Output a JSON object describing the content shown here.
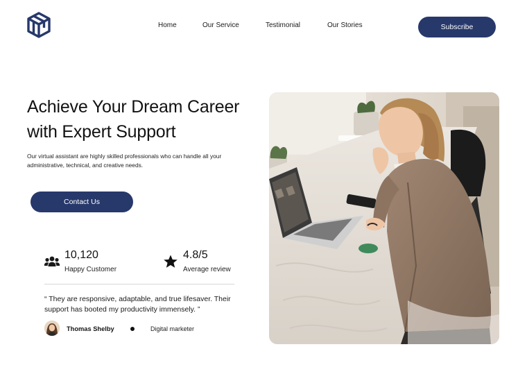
{
  "brand": {
    "logo_icon": "cube-logo-icon",
    "color": "#27386b"
  },
  "nav": {
    "items": [
      {
        "label": "Home"
      },
      {
        "label": "Our Service"
      },
      {
        "label": "Testimonial"
      },
      {
        "label": "Our Stories"
      }
    ],
    "subscribe_label": "Subscribe"
  },
  "hero": {
    "headline_line1": "Achieve Your Dream Career",
    "headline_line2": "with Expert Support",
    "subtext": "Our virtual assistant are highly skilled professionals who can handle all your administrative, technical, and creative needs.",
    "cta_label": "Contact Us",
    "image_icon": "woman-at-laptop-photo"
  },
  "stats": [
    {
      "icon": "users-icon",
      "value": "10,120",
      "label": "Happy Customer"
    },
    {
      "icon": "star-icon",
      "value": "4.8/5",
      "label": "Average review"
    }
  ],
  "testimonial": {
    "quote": "“ They are responsive, adaptable, and true lifesaver. Their support has booted my productivity immensely. ”",
    "author": "Thomas Shelby",
    "role": "Digital marketer"
  },
  "colors": {
    "accent": "#27386b",
    "text": "#121212",
    "divider": "#d6d6d6"
  }
}
